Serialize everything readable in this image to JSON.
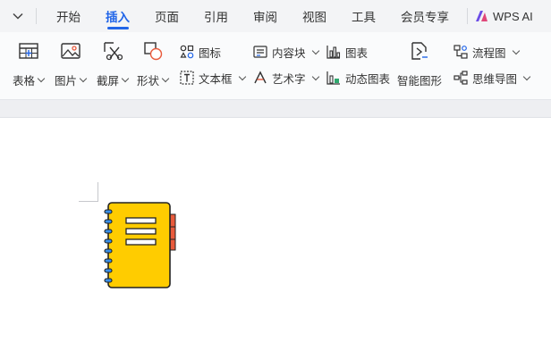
{
  "menubar": {
    "tabs": [
      {
        "label": "开始",
        "active": false
      },
      {
        "label": "插入",
        "active": true
      },
      {
        "label": "页面",
        "active": false
      },
      {
        "label": "引用",
        "active": false
      },
      {
        "label": "审阅",
        "active": false
      },
      {
        "label": "视图",
        "active": false
      },
      {
        "label": "工具",
        "active": false
      },
      {
        "label": "会员专享",
        "active": false
      }
    ],
    "ai_label": "WPS AI",
    "accent_color": "#2165e8"
  },
  "ribbon": {
    "table": "表格",
    "picture": "图片",
    "screenshot": "截屏",
    "shape": "形状",
    "icon": "图标",
    "textbox": "文本框",
    "content_block": "内容块",
    "wordart": "艺术字",
    "chart": "图表",
    "dynamic_chart": "动态图表",
    "smart_graphic": "智能图形",
    "flowchart": "流程图",
    "mindmap": "思维导图"
  },
  "document": {
    "clipart": "notebook-icon",
    "notebook_color": "#ffcc00",
    "tab_color": "#e85a3c"
  }
}
